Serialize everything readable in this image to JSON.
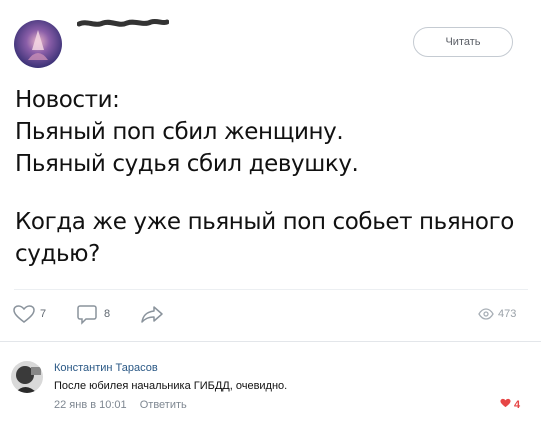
{
  "post": {
    "read_button": "Читать",
    "text_lines": [
      "Новости:",
      "Пьяный поп сбил женщину.",
      "Пьяный судья сбил девушку."
    ],
    "text_lines_2": [
      "Когда же уже пьяный поп собьет пьяного",
      "судью?"
    ]
  },
  "actions": {
    "likes": "7",
    "comments": "8",
    "views": "473"
  },
  "comment": {
    "author": "Константин Тарасов",
    "text": "После юбилея начальника ГИБДД, очевидно.",
    "time": "22 янв в 10:01",
    "reply_label": "Ответить",
    "likes": "4"
  },
  "colors": {
    "link": "#2a5885",
    "like_active": "#e64646",
    "muted": "#7e8791"
  }
}
